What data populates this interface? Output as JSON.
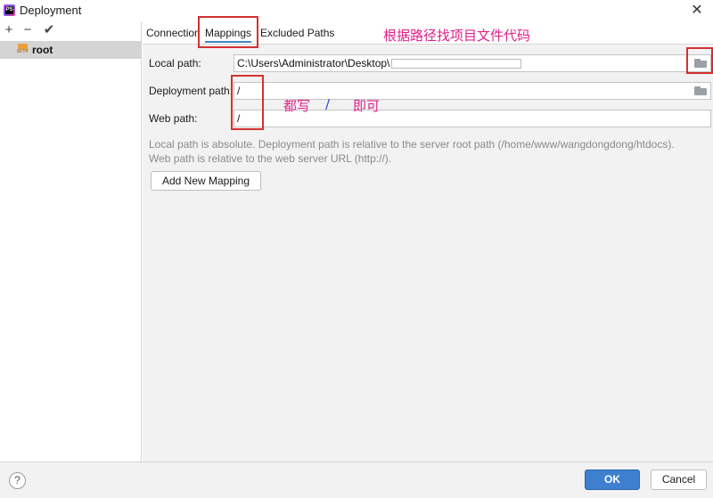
{
  "window": {
    "title": "Deployment",
    "app_icon": "PS"
  },
  "sidebar": {
    "toolbar": {
      "add": "+",
      "remove": "−",
      "apply": "✔"
    },
    "servers": [
      {
        "label": "root",
        "type_icon": "SFTP"
      }
    ]
  },
  "tabs": [
    {
      "label": "Connection",
      "active": false
    },
    {
      "label": "Mappings",
      "active": true
    },
    {
      "label": "Excluded Paths",
      "active": false
    }
  ],
  "form": {
    "local_path_label": "Local path:",
    "local_path_value": "C:\\Users\\Administrator\\Desktop\\",
    "deployment_path_label": "Deployment path:",
    "deployment_path_value": "/",
    "web_path_label": "Web path:",
    "web_path_value": "/"
  },
  "hint": {
    "line1": "Local path is absolute. Deployment path is relative to the server root path (/home/www/wangdongdong/htdocs).",
    "line2": "Web path is relative to the web server URL (http://)."
  },
  "add_mapping_label": "Add New Mapping",
  "annotations": {
    "project_path_note": "根据路径找项目文件代码",
    "write_slash_note_a": "都写",
    "write_slash_note_slash": "/",
    "write_slash_note_b": "即可"
  },
  "footer": {
    "help": "?",
    "ok": "OK",
    "cancel": "Cancel"
  },
  "colors": {
    "annotation_red": "#d43030",
    "annotation_magenta": "#e0208a",
    "annotation_blue": "#1a3fd0",
    "ok_blue": "#3f7fd0"
  }
}
